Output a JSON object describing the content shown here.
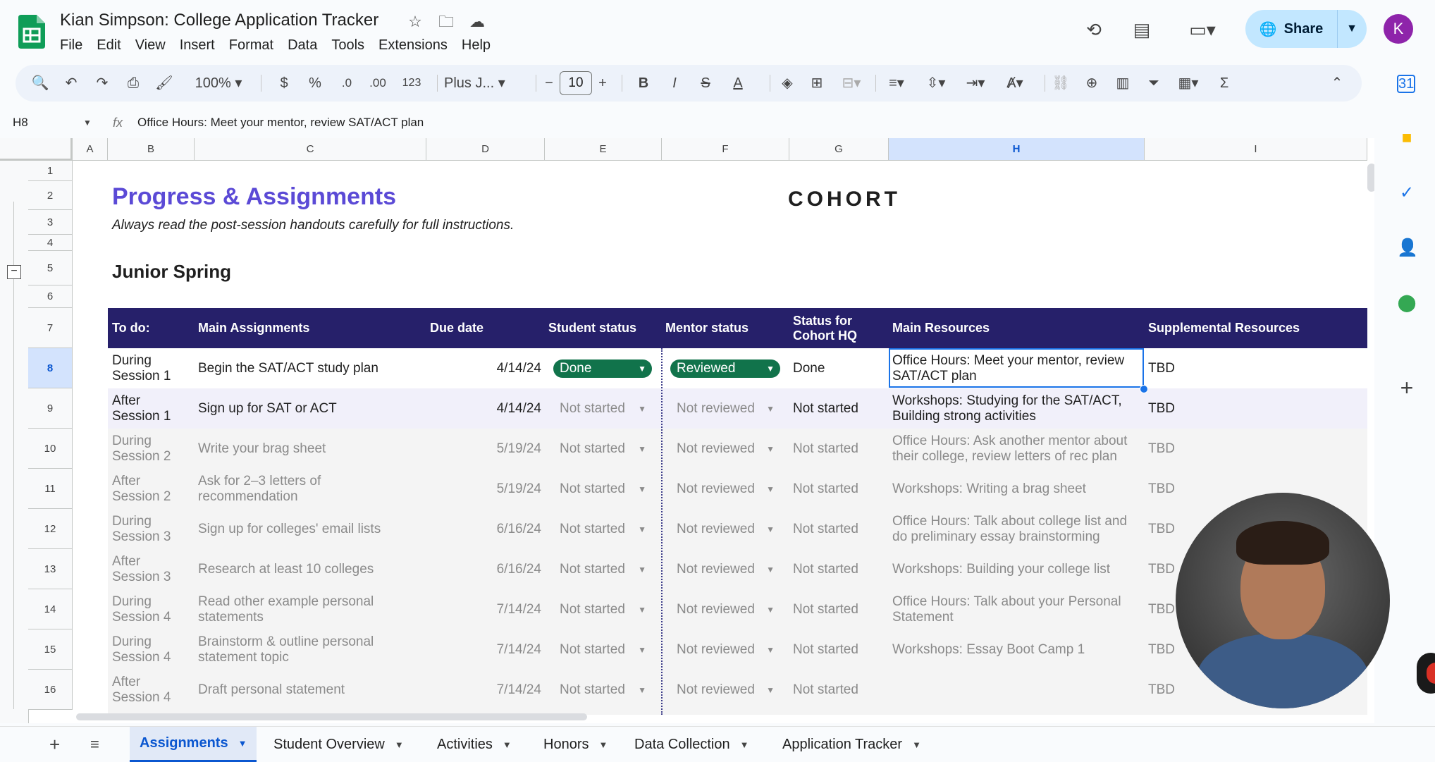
{
  "doc": {
    "title": "Kian Simpson: College Application Tracker",
    "menu": [
      "File",
      "Edit",
      "View",
      "Insert",
      "Format",
      "Data",
      "Tools",
      "Extensions",
      "Help"
    ],
    "share_label": "Share",
    "avatar_letter": "K"
  },
  "toolbar": {
    "zoom": "100%",
    "currency": "$",
    "percent": "%",
    "decrease_decimal": ".0",
    "increase_decimal": ".00",
    "number_format": "123",
    "font": "Plus J...",
    "font_size": "10"
  },
  "formula_bar": {
    "cell_ref": "H8",
    "fx": "fx",
    "content": "Office Hours: Meet your mentor, review SAT/ACT plan"
  },
  "columns": [
    "A",
    "B",
    "C",
    "D",
    "E",
    "F",
    "G",
    "H",
    "I"
  ],
  "row_numbers": [
    "1",
    "2",
    "3",
    "4",
    "5",
    "6",
    "7",
    "8",
    "9",
    "10",
    "11",
    "12",
    "13",
    "14",
    "15",
    "16"
  ],
  "sheet": {
    "title": "Progress & Assignments",
    "subtitle": "Always read the post-session handouts carefully for full instructions.",
    "logo_text": "COHORT",
    "section": "Junior Spring",
    "headers": {
      "todo": "To do:",
      "assignment": "Main Assignments",
      "due": "Due date",
      "student_status": "Student status",
      "mentor_status": "Mentor status",
      "hq_status": "Status for Cohort HQ",
      "main_resources": "Main Resources",
      "supp_resources": "Supplemental Resources"
    },
    "rows": [
      {
        "todo": "During Session 1",
        "assignment": "Begin the SAT/ACT study plan",
        "due": "4/14/24",
        "student": "Done",
        "mentor": "Reviewed",
        "hq": "Done",
        "resources": "Office Hours: Meet your mentor, review SAT/ACT plan",
        "supp": "TBD"
      },
      {
        "todo": "After Session 1",
        "assignment": "Sign up for SAT or ACT",
        "due": "4/14/24",
        "student": "Not started",
        "mentor": "Not reviewed",
        "hq": "Not started",
        "resources": "Workshops: Studying for the SAT/ACT, Building strong activities",
        "supp": "TBD"
      },
      {
        "todo": "During Session 2",
        "assignment": "Write your brag sheet",
        "due": "5/19/24",
        "student": "Not started",
        "mentor": "Not reviewed",
        "hq": "Not started",
        "resources": "Office Hours: Ask another mentor about their college, review letters of rec plan",
        "supp": "TBD"
      },
      {
        "todo": "After Session 2",
        "assignment": "Ask for 2–3 letters of recommendation",
        "due": "5/19/24",
        "student": "Not started",
        "mentor": "Not reviewed",
        "hq": "Not started",
        "resources": "Workshops: Writing a brag sheet",
        "supp": "TBD"
      },
      {
        "todo": "During Session 3",
        "assignment": "Sign up for colleges' email lists",
        "due": "6/16/24",
        "student": "Not started",
        "mentor": "Not reviewed",
        "hq": "Not started",
        "resources": "Office Hours: Talk about college list and do preliminary essay brainstorming",
        "supp": "TBD"
      },
      {
        "todo": "After Session 3",
        "assignment": "Research at least 10 colleges",
        "due": "6/16/24",
        "student": "Not started",
        "mentor": "Not reviewed",
        "hq": "Not started",
        "resources": "Workshops: Building your college list",
        "supp": "TBD"
      },
      {
        "todo": "During Session 4",
        "assignment": "Read other example personal statements",
        "due": "7/14/24",
        "student": "Not started",
        "mentor": "Not reviewed",
        "hq": "Not started",
        "resources": "Office Hours: Talk about your Personal Statement",
        "supp": "TBD"
      },
      {
        "todo": "During Session 4",
        "assignment": "Brainstorm & outline personal statement topic",
        "due": "7/14/24",
        "student": "Not started",
        "mentor": "Not reviewed",
        "hq": "Not started",
        "resources": "Workshops: Essay Boot Camp 1",
        "supp": "TBD"
      },
      {
        "todo": "After Session 4",
        "assignment": "Draft personal statement",
        "due": "7/14/24",
        "student": "Not started",
        "mentor": "Not reviewed",
        "hq": "Not started",
        "resources": "",
        "supp": "TBD"
      }
    ]
  },
  "sheet_tabs": [
    "Assignments",
    "Student Overview",
    "Activities",
    "Honors",
    "Data Collection",
    "Application Tracker"
  ],
  "colors": {
    "header_bg": "#26206a",
    "title_purple": "#5b4ad6",
    "done_chip": "#11734b",
    "selection": "#1a73e8"
  }
}
